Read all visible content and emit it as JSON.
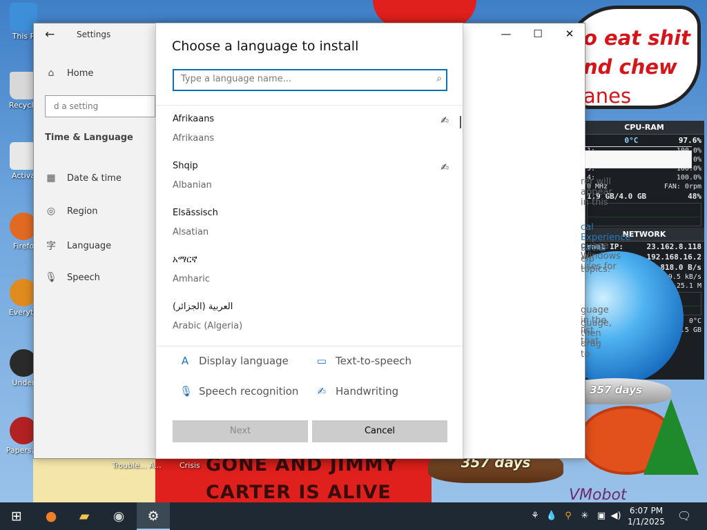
{
  "desktop": {
    "icons": [
      {
        "label": "This P",
        "color": "#3c8fd8"
      },
      {
        "label": "Recycle",
        "color": "#d8d8d8"
      },
      {
        "label": "Activa",
        "color": "#e8e8e8"
      },
      {
        "label": "Firefo",
        "color": "#e06a22"
      },
      {
        "label": "Everyth",
        "color": "#e08b1e"
      },
      {
        "label": "Under",
        "color": "#2a2a2a"
      },
      {
        "label": "Papers, P",
        "color": "#b22222"
      }
    ],
    "speech_lines": [
      "o eat shit",
      "nd chew",
      "anes"
    ],
    "banner_lines": [
      "GONE AND JIMMY",
      "CARTER IS ALIVE"
    ],
    "bottom_labels": {
      "trouble": "Trouble... A...",
      "crisis": "Crisis",
      "vmobot": "VMobot"
    }
  },
  "widget": {
    "cpu_title": "CPU-RAM",
    "cpu_temp": "0°C",
    "cpu_total": "97.6%",
    "cores": [
      {
        "label": "1:",
        "value": "100.0%"
      },
      {
        "label": "2:",
        "value": "100.0%"
      },
      {
        "label": "3:",
        "value": "100.0%"
      },
      {
        "label": "4:",
        "value": "100.0%"
      }
    ],
    "freq": "0 MHz",
    "fan": "FAN: 0rpm",
    "ram": "1.9 GB/4.0 GB",
    "ram_pct": "48%",
    "net_title": "NETWORK",
    "internal_ip_label": "rnal IP:",
    "internal_ip": "23.162.8.118",
    "local_ip": "192.168.16.2",
    "up": "818.0 B/s",
    "down": "159.5 kB/s",
    "total": "25.1 M",
    "extra_temp": "0°C",
    "extra_size": "9.5 GB"
  },
  "globes": {
    "left_label": "357 days",
    "right_label": "357 days"
  },
  "settings": {
    "window_title": "Settings",
    "back_icon": "←",
    "home": "Home",
    "search_placeholder": "d a setting",
    "section_title": "Time & Language",
    "nav_items": [
      {
        "label": "Date & time",
        "icon": "calendar-icon"
      },
      {
        "label": "Region",
        "icon": "globe-icon"
      },
      {
        "label": "Language",
        "icon": "language-icon"
      },
      {
        "label": "Speech",
        "icon": "microphone-icon"
      }
    ],
    "minimize": "—",
    "maximize": "☐",
    "close": "✕",
    "background_text": {
      "line1": "rer will appear in this",
      "link": "cal Experience Packs",
      "line2": "guage Windows uses for",
      "line3": "elp topics.",
      "line4": "guage in the list that",
      "line5": "guage, then drag to"
    }
  },
  "dialog": {
    "title": "Choose a language to install",
    "search_placeholder": "Type a language name...",
    "languages": [
      {
        "native": "Afrikaans",
        "english": "Afrikaans",
        "handwriting": true
      },
      {
        "native": "Shqip",
        "english": "Albanian",
        "handwriting": true
      },
      {
        "native": "Elsässisch",
        "english": "Alsatian",
        "handwriting": false
      },
      {
        "native": "አማርኛ",
        "english": "Amharic",
        "handwriting": false
      },
      {
        "native": "العربية (الجزائر)",
        "english": "Arabic (Algeria)",
        "handwriting": false
      }
    ],
    "features": {
      "display_language": "Display language",
      "text_to_speech": "Text-to-speech",
      "speech_recognition": "Speech recognition",
      "handwriting": "Handwriting"
    },
    "next_label": "Next",
    "cancel_label": "Cancel"
  },
  "taskbar": {
    "time": "6:07 PM",
    "date": "1/1/2025"
  }
}
